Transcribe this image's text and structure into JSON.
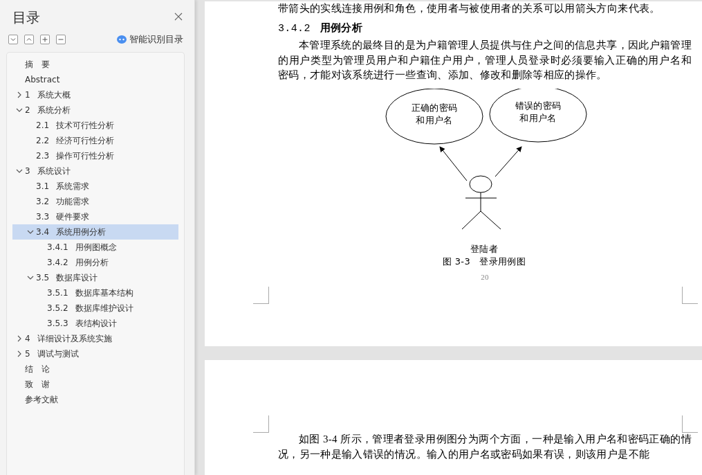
{
  "sidebar": {
    "title": "目录",
    "toolbar": [
      {
        "kind": "collapse"
      },
      {
        "kind": "expand"
      },
      {
        "kind": "add"
      },
      {
        "kind": "remove"
      }
    ],
    "smart_button": "智能识别目录",
    "items": [
      {
        "title": "摘　要",
        "selected": false
      },
      {
        "title": "Abstract",
        "selected": false
      },
      {
        "number": "1",
        "title": "系统大概",
        "selected": false,
        "expanded": false
      },
      {
        "number": "2",
        "title": "系统分析",
        "selected": false,
        "expanded": true,
        "children": [
          {
            "number": "2.1",
            "title": "技术可行性分析",
            "selected": false
          },
          {
            "number": "2.2",
            "title": "经济可行性分析",
            "selected": false
          },
          {
            "number": "2.3",
            "title": "操作可行性分析",
            "selected": false
          }
        ]
      },
      {
        "number": "3",
        "title": "系统设计",
        "selected": false,
        "expanded": true,
        "children": [
          {
            "number": "3.1",
            "title": "系统需求",
            "selected": false
          },
          {
            "number": "3.2",
            "title": "功能需求",
            "selected": false
          },
          {
            "number": "3.3",
            "title": "硬件要求",
            "selected": false
          },
          {
            "number": "3.4",
            "title": "系统用例分析",
            "selected": true,
            "expanded": true,
            "children": [
              {
                "number": "3.4.1",
                "title": "用例图概念",
                "selected": false
              },
              {
                "number": "3.4.2",
                "title": "用例分析",
                "selected": false
              }
            ]
          },
          {
            "number": "3.5",
            "title": "数据库设计",
            "selected": false,
            "expanded": true,
            "children": [
              {
                "number": "3.5.1",
                "title": "数据库基本结构",
                "selected": false
              },
              {
                "number": "3.5.2",
                "title": "数据库维护设计",
                "selected": false
              },
              {
                "number": "3.5.3",
                "title": "表结构设计",
                "selected": false
              }
            ]
          }
        ]
      },
      {
        "number": "4",
        "title": "详细设计及系统实施",
        "selected": false,
        "expanded": false
      },
      {
        "number": "5",
        "title": "调试与测试",
        "selected": false,
        "expanded": false
      },
      {
        "title": "结　论",
        "selected": false
      },
      {
        "title": "致　谢",
        "selected": false
      },
      {
        "title": "参考文献",
        "selected": false
      }
    ]
  },
  "pages": [
    {
      "blocks": [
        {
          "kind": "text",
          "text": "带箭头的实线连接用例和角色，使用者与被使用者的关系可以用箭头方向来代表。"
        },
        {
          "kind": "heading",
          "number": "3.4.2",
          "text": "用例分析"
        },
        {
          "kind": "paragraph",
          "text": "本管理系统的最终目的是为户籍管理人员提供与住户之间的信息共享，因此户籍管理的用户类型为管理员用户和户籍住户用户，管理人员登录时必须要输入正确的用户名和密码，才能对该系统进行一些查询、添加、修改和删除等相应的操作。"
        },
        {
          "kind": "diagram",
          "use_cases": [
            {
              "lines": [
                "正确的密码",
                "和用户名"
              ]
            },
            {
              "lines": [
                "错误的密码",
                "和用户名"
              ]
            }
          ],
          "actor": "登陆者",
          "caption": "图 3-3　登录用例图"
        }
      ],
      "page_number": "20"
    },
    {
      "blocks": [
        {
          "kind": "paragraph",
          "text": "如图 3-4 所示，管理者登录用例图分为两个方面，一种是输入用户名和密码正确的情况，另一种是输入错误的情况。输入的用户名或密码如果有误，则该用户是不能"
        }
      ]
    }
  ]
}
